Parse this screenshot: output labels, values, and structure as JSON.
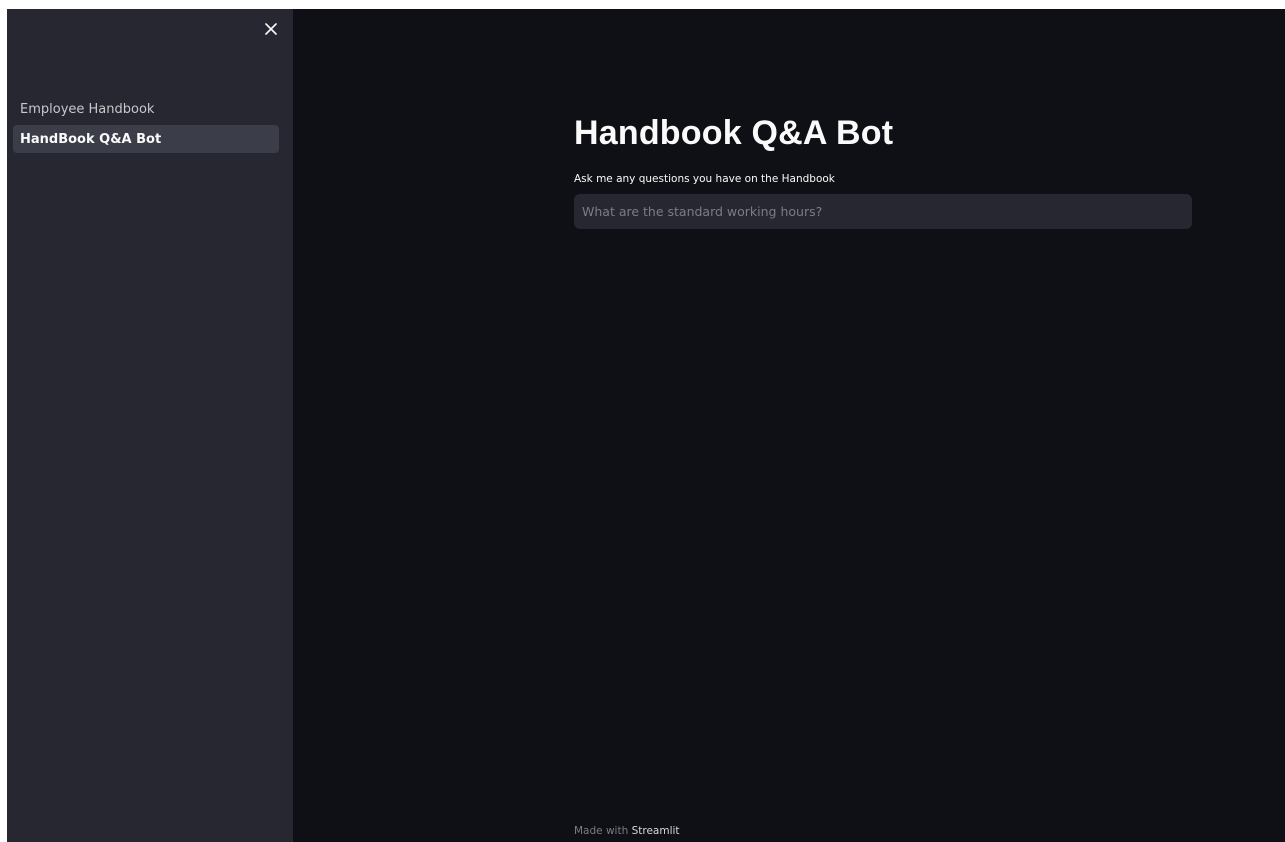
{
  "sidebar": {
    "close_icon": "close-icon",
    "items": [
      {
        "label": "Employee Handbook",
        "active": false
      },
      {
        "label": "HandBook Q&A Bot",
        "active": true
      }
    ]
  },
  "main": {
    "title": "Handbook Q&A Bot",
    "input_label": "Ask me any questions you have on the Handbook",
    "input_value": "",
    "input_placeholder": "What are the standard working hours?"
  },
  "footer": {
    "prefix": "Made with ",
    "brand": "Streamlit"
  },
  "colors": {
    "background": "#0f1015",
    "sidebar": "#262730",
    "active_item": "#3b3d48",
    "text": "#fafafa",
    "muted_text": "#7a7c86"
  }
}
